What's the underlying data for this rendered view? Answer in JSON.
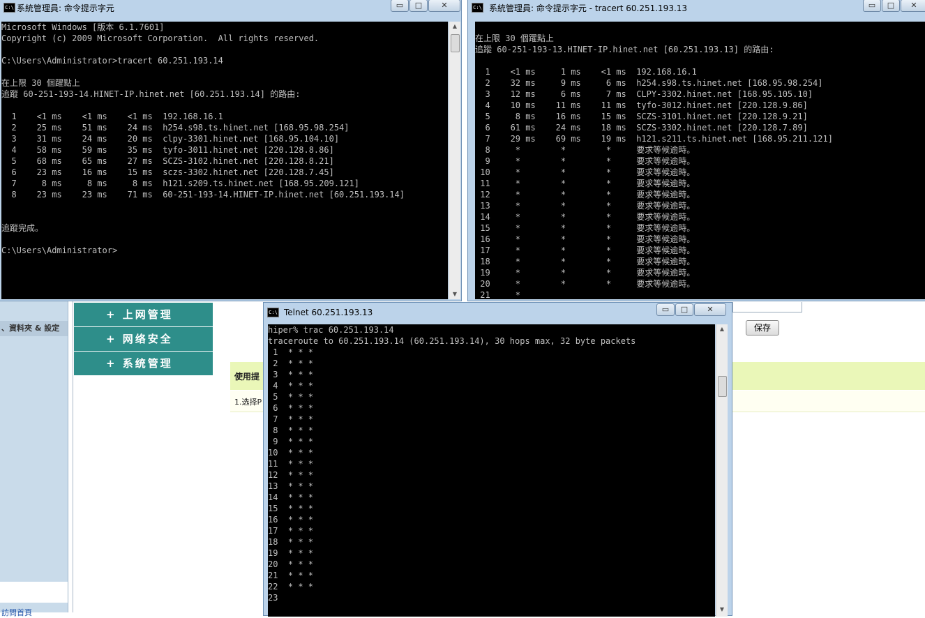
{
  "background_page": {
    "left_nav_item": "、資料夾 & 設定",
    "left_nav_link": "訪問首頁",
    "menu": [
      "+ 上网管理",
      "+ 网络安全",
      "+ 系统管理"
    ],
    "hint_title": "使用提",
    "hint_row": "1.选择P",
    "save_label": "保存"
  },
  "win1": {
    "title": "系統管理員: 命令提示字元",
    "lines": [
      "Microsoft Windows [版本 6.1.7601]",
      "Copyright (c) 2009 Microsoft Corporation.  All rights reserved.",
      "",
      "C:\\Users\\Administrator>tracert 60.251.193.14",
      "",
      "在上限 30 個躍點上",
      "追蹤 60-251-193-14.HINET-IP.hinet.net [60.251.193.14] 的路由:",
      "",
      "  1    <1 ms    <1 ms    <1 ms  192.168.16.1",
      "  2    25 ms    51 ms    24 ms  h254.s98.ts.hinet.net [168.95.98.254]",
      "  3    31 ms    24 ms    20 ms  clpy-3301.hinet.net [168.95.104.10]",
      "  4    58 ms    59 ms    35 ms  tyfo-3011.hinet.net [220.128.8.86]",
      "  5    68 ms    65 ms    27 ms  SCZS-3102.hinet.net [220.128.8.21]",
      "  6    23 ms    16 ms    15 ms  sczs-3302.hinet.net [220.128.7.45]",
      "  7     8 ms     8 ms     8 ms  h121.s209.ts.hinet.net [168.95.209.121]",
      "  8    23 ms    23 ms    71 ms  60-251-193-14.HINET-IP.hinet.net [60.251.193.14]",
      "",
      "",
      "追蹤完成。",
      "",
      "C:\\Users\\Administrator>"
    ]
  },
  "win2": {
    "title": "系統管理員: 命令提示字元 - tracert  60.251.193.13",
    "lines": [
      "",
      "在上限 30 個躍點上",
      "追蹤 60-251-193-13.HINET-IP.hinet.net [60.251.193.13] 的路由:",
      "",
      "  1    <1 ms     1 ms    <1 ms  192.168.16.1",
      "  2    32 ms     9 ms     6 ms  h254.s98.ts.hinet.net [168.95.98.254]",
      "  3    12 ms     6 ms     7 ms  CLPY-3302.hinet.net [168.95.105.10]",
      "  4    10 ms    11 ms    11 ms  tyfo-3012.hinet.net [220.128.9.86]",
      "  5     8 ms    16 ms    15 ms  SCZS-3101.hinet.net [220.128.9.21]",
      "  6    61 ms    24 ms    18 ms  SCZS-3302.hinet.net [220.128.7.89]",
      "  7    29 ms    69 ms    19 ms  h121.s211.ts.hinet.net [168.95.211.121]",
      "  8     *        *        *     要求等候逾時。",
      "  9     *        *        *     要求等候逾時。",
      " 10     *        *        *     要求等候逾時。",
      " 11     *        *        *     要求等候逾時。",
      " 12     *        *        *     要求等候逾時。",
      " 13     *        *        *     要求等候逾時。",
      " 14     *        *        *     要求等候逾時。",
      " 15     *        *        *     要求等候逾時。",
      " 16     *        *        *     要求等候逾時。",
      " 17     *        *        *     要求等候逾時。",
      " 18     *        *        *     要求等候逾時。",
      " 19     *        *        *     要求等候逾時。",
      " 20     *        *        *     要求等候逾時。",
      " 21     *"
    ]
  },
  "win3": {
    "title": "Telnet 60.251.193.13",
    "lines": [
      "hiper% trac 60.251.193.14",
      "traceroute to 60.251.193.14 (60.251.193.14), 30 hops max, 32 byte packets",
      " 1  * * *",
      " 2  * * *",
      " 3  * * *",
      " 4  * * *",
      " 5  * * *",
      " 6  * * *",
      " 7  * * *",
      " 8  * * *",
      " 9  * * *",
      "10  * * *",
      "11  * * *",
      "12  * * *",
      "13  * * *",
      "14  * * *",
      "15  * * *",
      "16  * * *",
      "17  * * *",
      "18  * * *",
      "19  * * *",
      "20  * * *",
      "21  * * *",
      "22  * * *",
      "23"
    ]
  },
  "window_buttons": {
    "minimize": "▭",
    "maximize": "□",
    "close": "✕"
  },
  "icons": [
    "console-icon",
    "minimize-icon",
    "maximize-icon",
    "close-icon",
    "scroll-up-icon",
    "scroll-down-icon"
  ]
}
